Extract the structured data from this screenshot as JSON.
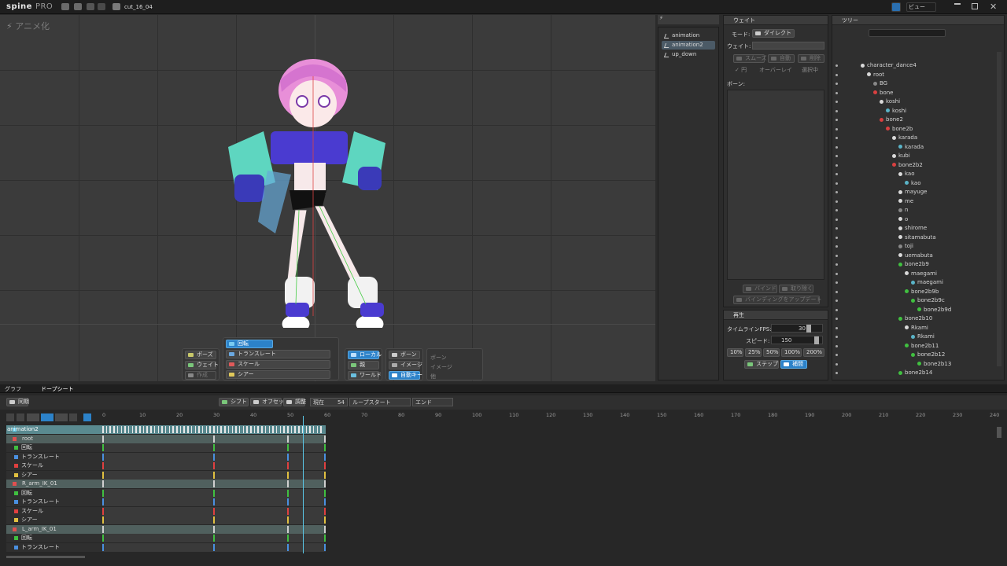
{
  "topbar": {
    "logo": "spine",
    "edition": "PRO",
    "file": "cut_16_04",
    "view_label": "ビュー"
  },
  "viewport": {
    "mode_label": "アニメ化"
  },
  "tools": {
    "transform": [
      "回転",
      "トランスレート",
      "スケール",
      "シアー"
    ],
    "pose": [
      "ポーズ",
      "ウェイト",
      "作成"
    ],
    "axes": [
      "ローカル",
      "親",
      "ワールド"
    ],
    "keys": [
      "ボーン",
      "イメージ",
      "自動キー"
    ],
    "compensate": [
      "ボーン",
      "イメージ",
      "他"
    ]
  },
  "animations": {
    "items": [
      "animation",
      "animation2",
      "up_down"
    ],
    "selected_index": 1
  },
  "weights": {
    "title": "ウェイト",
    "mode_label": "モード:",
    "mode_value": "ダイレクト",
    "weight_label": "ウェイト:",
    "smooth": "スムーズ",
    "auto": "自動",
    "delete": "削除",
    "circle": "円",
    "overlay": "オーバーレイ",
    "selected": "選択中",
    "bones_label": "ボーン:",
    "bind": "バインド",
    "remove": "取り除く",
    "update": "バインディングをアップデート"
  },
  "playback": {
    "title": "再生",
    "fps_label": "タイムラインFPS:",
    "fps_value": "30",
    "speed_label": "スピード:",
    "speed_value": "150",
    "speeds": [
      "10%",
      "25%",
      "50%",
      "100%",
      "200%"
    ],
    "step": "ステップ",
    "interpolate": "補間"
  },
  "tree": {
    "title": "ツリー",
    "nodes": [
      {
        "label": "character_dance4",
        "indent": 0,
        "color": "#d9d9d9"
      },
      {
        "label": "root",
        "indent": 1,
        "color": "#d9d9d9"
      },
      {
        "label": "BG",
        "indent": 2,
        "color": "#888888"
      },
      {
        "label": "bone",
        "indent": 2,
        "color": "#d94040"
      },
      {
        "label": "koshi",
        "indent": 3,
        "color": "#d9d9d9"
      },
      {
        "label": "koshi",
        "indent": 4,
        "color": "#5ab4c8"
      },
      {
        "label": "bone2",
        "indent": 3,
        "color": "#d94040"
      },
      {
        "label": "bone2b",
        "indent": 4,
        "color": "#d94040"
      },
      {
        "label": "karada",
        "indent": 5,
        "color": "#d9d9d9"
      },
      {
        "label": "karada",
        "indent": 6,
        "color": "#5ab4c8"
      },
      {
        "label": "kubi",
        "indent": 5,
        "color": "#d9d9d9"
      },
      {
        "label": "bone2b2",
        "indent": 5,
        "color": "#d94040"
      },
      {
        "label": "kao",
        "indent": 6,
        "color": "#d9d9d9"
      },
      {
        "label": "kao",
        "indent": 7,
        "color": "#5ab4c8"
      },
      {
        "label": "mayuge",
        "indent": 6,
        "color": "#d9d9d9"
      },
      {
        "label": "me",
        "indent": 6,
        "color": "#d9d9d9"
      },
      {
        "label": "n",
        "indent": 6,
        "color": "#888888"
      },
      {
        "label": "o",
        "indent": 6,
        "color": "#d9d9d9"
      },
      {
        "label": "shirome",
        "indent": 6,
        "color": "#d9d9d9"
      },
      {
        "label": "sitamabuta",
        "indent": 6,
        "color": "#d9d9d9"
      },
      {
        "label": "toji",
        "indent": 6,
        "color": "#888888"
      },
      {
        "label": "uemabuta",
        "indent": 6,
        "color": "#d9d9d9"
      },
      {
        "label": "bone2b9",
        "indent": 6,
        "color": "#40c040"
      },
      {
        "label": "maegami",
        "indent": 7,
        "color": "#d9d9d9"
      },
      {
        "label": "maegami",
        "indent": 8,
        "color": "#5ab4c8"
      },
      {
        "label": "bone2b9b",
        "indent": 7,
        "color": "#40c040"
      },
      {
        "label": "bone2b9c",
        "indent": 8,
        "color": "#40c040"
      },
      {
        "label": "bone2b9d",
        "indent": 9,
        "color": "#40c040"
      },
      {
        "label": "bone2b10",
        "indent": 6,
        "color": "#40c040"
      },
      {
        "label": "Rkami",
        "indent": 7,
        "color": "#d9d9d9"
      },
      {
        "label": "Rkami",
        "indent": 8,
        "color": "#5ab4c8"
      },
      {
        "label": "bone2b11",
        "indent": 7,
        "color": "#40c040"
      },
      {
        "label": "bone2b12",
        "indent": 8,
        "color": "#40c040"
      },
      {
        "label": "bone2b13",
        "indent": 9,
        "color": "#40c040"
      },
      {
        "label": "bone2b14",
        "indent": 6,
        "color": "#40c040"
      }
    ]
  },
  "dopesheet": {
    "tab_graph": "グラフ",
    "tab_dope": "ドープシート",
    "sync": "同期",
    "shift": "シフト",
    "offset": "オフセット",
    "adjust": "調整",
    "current_label": "現在",
    "current_value": "54",
    "loop_start": "ループスタート",
    "end": "エンド",
    "ruler": [
      "0",
      "10",
      "20",
      "30",
      "40",
      "50",
      "60",
      "70",
      "80",
      "90",
      "100",
      "110",
      "120",
      "130",
      "140",
      "150",
      "160",
      "170",
      "180",
      "190",
      "200",
      "210",
      "220",
      "230",
      "240"
    ],
    "rows": [
      {
        "label": "animation2",
        "kind": "anim"
      },
      {
        "label": "root",
        "kind": "bone"
      },
      {
        "label": "回転",
        "kind": "rot"
      },
      {
        "label": "トランスレート",
        "kind": "trans"
      },
      {
        "label": "スケール",
        "kind": "scale"
      },
      {
        "label": "シアー",
        "kind": "shear"
      },
      {
        "label": "R_arm_IK_01",
        "kind": "bone"
      },
      {
        "label": "回転",
        "kind": "rot"
      },
      {
        "label": "トランスレート",
        "kind": "trans"
      },
      {
        "label": "スケール",
        "kind": "scale"
      },
      {
        "label": "シアー",
        "kind": "shear"
      },
      {
        "label": "L_arm_IK_01",
        "kind": "bone"
      },
      {
        "label": "回転",
        "kind": "rot"
      },
      {
        "label": "トランスレート",
        "kind": "trans"
      }
    ]
  }
}
